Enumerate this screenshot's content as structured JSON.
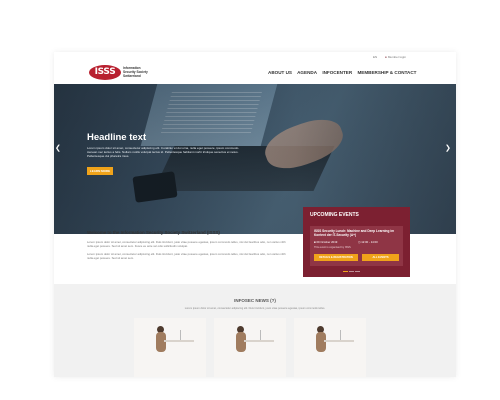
{
  "topbar": {
    "language": "EN",
    "login": "Member login"
  },
  "logo": {
    "mark": "ISSS",
    "text_line1": "Information",
    "text_line2": "Security Society",
    "text_line3": "Switzerland"
  },
  "nav": {
    "items": [
      {
        "label": "ABOUT US"
      },
      {
        "label": "AGENDA"
      },
      {
        "label": "INFOCENTER"
      },
      {
        "label": "MEMBERSHIP & CONTACT"
      }
    ]
  },
  "hero": {
    "headline": "Headline text",
    "text": "Lorem ipsum dolor sit amet, consectetur adipiscing elit. Curabitur et dui urna, nulla eget posuere, ipsum commodo. Aenean nec lectus a felis. Nullam mollis volutpat lectus id. Pellentesque habitant morbi tristique senectus et netus. Pellentesque dui pharetra risus.",
    "button": "LEARN MORE"
  },
  "events": {
    "title": "UPCOMING EVENTS",
    "event_name": "ISSS Security Lunch: Machine and Deep Learning im Kontext der IT-Security (A+)",
    "date": "09 October 2019",
    "time": "12:00 - 14:00",
    "note": "This event is organised by ISSS",
    "details_button": "DETAILS & REGISTRATION",
    "all_button": "ALL EVENTS"
  },
  "welcome": {
    "title": "Welcome to the Information Security Society Switzerland (ISSS)",
    "para1": "Lorem ipsum dolor sit amet, consectetur adipiscing elit. Duis tincidunt, justo vitae posuere egestas, ipsum commodo tellus, nisi dui faucibus odio, non varius nibh nulla eget posuere. Sed sit amet sem. Fusce eu ante vel odio sollicitudin volutpat.",
    "para2": "Lorem ipsum dolor sit amet, consectetur adipiscing elit. Duis tincidunt, justo vitae posuere egestas, ipsum commodo tellus, nisi dui faucibus odio, non varius nibh nulla eget posuere. Sed sit amet sem."
  },
  "news": {
    "title": "INFOSEC NEWS (?)",
    "subtitle": "Lorem ipsum dolor sit amet, consectetur adipiscing elit. Duis tincidunt, justo vitae posuere egestas, ipsum commodo tellus."
  },
  "colors": {
    "brand_red": "#b8202f",
    "events_maroon": "#7c2031",
    "accent_orange": "#f0a31a"
  }
}
